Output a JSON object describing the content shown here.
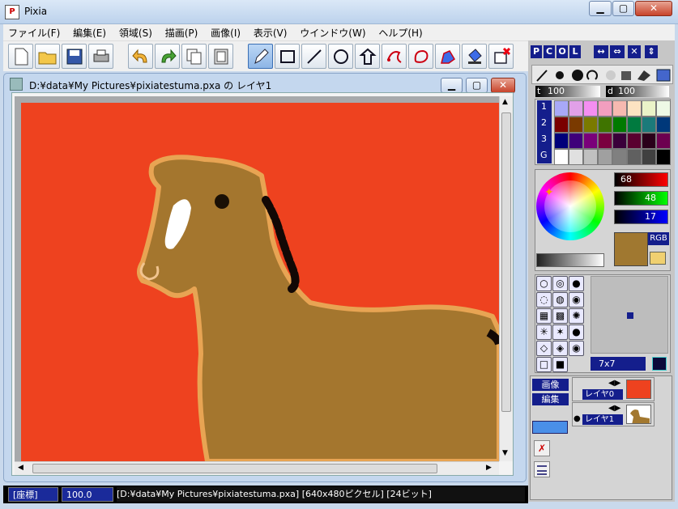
{
  "app": {
    "title": "Pixia"
  },
  "menu": [
    "ファイル(F)",
    "編集(E)",
    "領域(S)",
    "描画(P)",
    "画像(I)",
    "表示(V)",
    "ウインドウ(W)",
    "ヘルプ(H)"
  ],
  "doc": {
    "title": "D:¥data¥My Pictures¥pixiatestuma.pxa の レイヤ1"
  },
  "panel_tabs": [
    "P",
    "C",
    "O",
    "L"
  ],
  "palette": {
    "opacity_t": "t",
    "opacity_value": "100",
    "d_label": "d",
    "d_value": "100",
    "rows": [
      "1",
      "2",
      "3",
      "G"
    ],
    "colors": [
      [
        "#a8a8f8",
        "#e1a0e8",
        "#f48ef1",
        "#f29ebf",
        "#f6b9b0",
        "#fde3c2",
        "#eaf3c8",
        "#eef9e6"
      ],
      [
        "#7a0000",
        "#7a3a00",
        "#7a7a00",
        "#3f7400",
        "#007a00",
        "#007a3f",
        "#1b7a7a",
        "#00387a"
      ],
      [
        "#00007a",
        "#3f007a",
        "#7a007a",
        "#7a003f",
        "#3a003a",
        "#5a0030",
        "#2a001a",
        "#6d0050"
      ],
      [
        "#ffffff",
        "#e0e0e0",
        "#c0c0c0",
        "#a0a0a0",
        "#808080",
        "#606060",
        "#404040",
        "#000000"
      ]
    ]
  },
  "color_picker": {
    "r": "68",
    "g": "48",
    "b": "17",
    "mode_label": "RGB",
    "current_color": "#a07830"
  },
  "brush_panel": {
    "size_label": "7x7"
  },
  "layers": {
    "image_label": "画像",
    "edit_label": "編集",
    "layer0": "レイヤ0",
    "layer1": "レイヤ1"
  },
  "status": {
    "coord": "[座標]",
    "zoom": "100.0",
    "info": "[D:¥data¥My Pictures¥pixiatestuma.pxa] [640x480ピクセル] [24ビット]"
  },
  "colors": {
    "canvas_bg": "#ee421f",
    "horse": "#a3782f",
    "accent_blue": "#141e8c"
  }
}
